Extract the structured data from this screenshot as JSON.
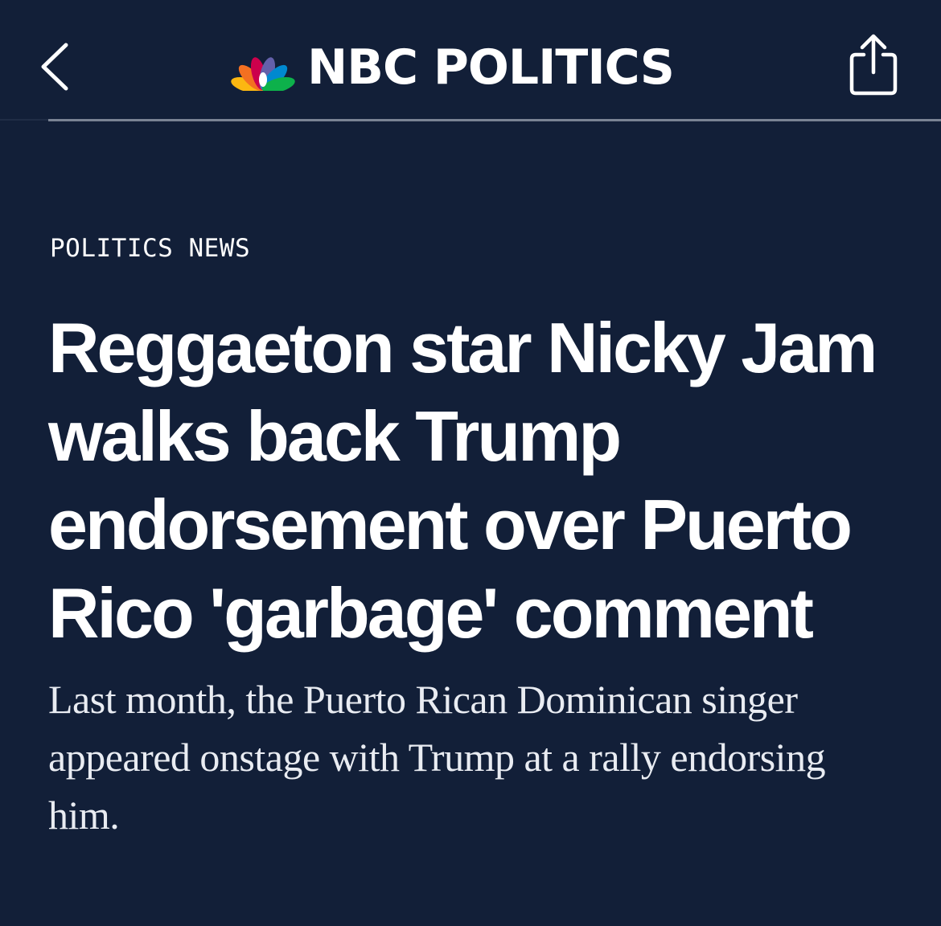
{
  "header": {
    "brand_name": "NBC POLITICS",
    "back_icon": "chevron-left-icon",
    "share_icon": "share-icon",
    "logo_icon": "nbc-peacock-icon"
  },
  "article": {
    "kicker": "POLITICS NEWS",
    "headline": "Reggaeton star Nicky Jam walks back Trump endorsement over Puerto Rico 'garbage' comment",
    "dek": "Last month, the Puerto Rican Dominican singer appeared onstage with Trump at a rally endorsing him."
  },
  "colors": {
    "background": "#121f38",
    "text": "#ffffff",
    "divider": "#7a8394",
    "peacock": [
      "#fcb711",
      "#f37021",
      "#cc004c",
      "#6460aa",
      "#0089d0",
      "#0db14b"
    ]
  }
}
